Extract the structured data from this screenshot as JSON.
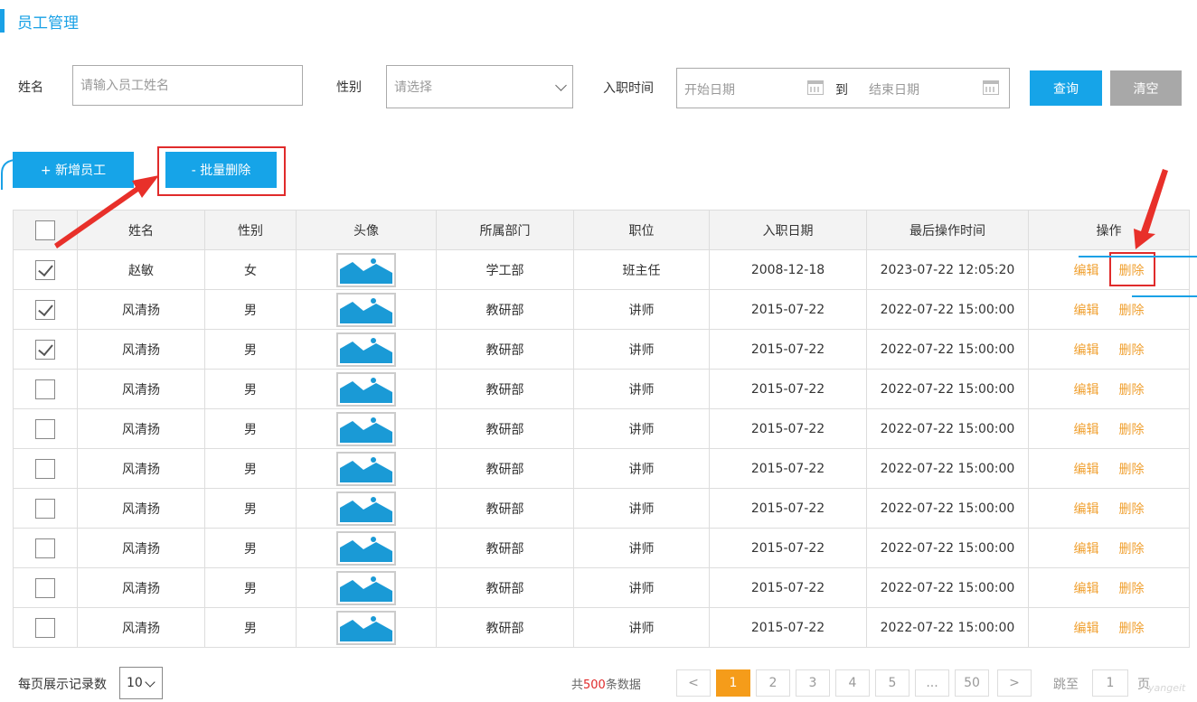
{
  "page": {
    "title": "员工管理"
  },
  "search": {
    "name_label": "姓名",
    "name_placeholder": "请输入员工姓名",
    "gender_label": "性别",
    "gender_placeholder": "请选择",
    "entry_label": "入职时间",
    "start_placeholder": "开始日期",
    "to_label": "到",
    "end_placeholder": "结束日期",
    "query_label": "查询",
    "clear_label": "清空"
  },
  "actions": {
    "add_label": "+ 新增员工",
    "batch_delete_label": "- 批量删除"
  },
  "table": {
    "headers": [
      "姓名",
      "性别",
      "头像",
      "所属部门",
      "职位",
      "入职日期",
      "最后操作时间",
      "操作"
    ],
    "edit_label": "编辑",
    "delete_label": "删除",
    "rows": [
      {
        "checked": true,
        "name": "赵敏",
        "gender": "女",
        "dept": "学工部",
        "position": "班主任",
        "entry": "2008-12-18",
        "updated": "2023-07-22 12:05:20"
      },
      {
        "checked": true,
        "name": "风清扬",
        "gender": "男",
        "dept": "教研部",
        "position": "讲师",
        "entry": "2015-07-22",
        "updated": "2022-07-22 15:00:00"
      },
      {
        "checked": true,
        "name": "风清扬",
        "gender": "男",
        "dept": "教研部",
        "position": "讲师",
        "entry": "2015-07-22",
        "updated": "2022-07-22 15:00:00"
      },
      {
        "checked": false,
        "name": "风清扬",
        "gender": "男",
        "dept": "教研部",
        "position": "讲师",
        "entry": "2015-07-22",
        "updated": "2022-07-22 15:00:00"
      },
      {
        "checked": false,
        "name": "风清扬",
        "gender": "男",
        "dept": "教研部",
        "position": "讲师",
        "entry": "2015-07-22",
        "updated": "2022-07-22 15:00:00"
      },
      {
        "checked": false,
        "name": "风清扬",
        "gender": "男",
        "dept": "教研部",
        "position": "讲师",
        "entry": "2015-07-22",
        "updated": "2022-07-22 15:00:00"
      },
      {
        "checked": false,
        "name": "风清扬",
        "gender": "男",
        "dept": "教研部",
        "position": "讲师",
        "entry": "2015-07-22",
        "updated": "2022-07-22 15:00:00"
      },
      {
        "checked": false,
        "name": "风清扬",
        "gender": "男",
        "dept": "教研部",
        "position": "讲师",
        "entry": "2015-07-22",
        "updated": "2022-07-22 15:00:00"
      },
      {
        "checked": false,
        "name": "风清扬",
        "gender": "男",
        "dept": "教研部",
        "position": "讲师",
        "entry": "2015-07-22",
        "updated": "2022-07-22 15:00:00"
      },
      {
        "checked": false,
        "name": "风清扬",
        "gender": "男",
        "dept": "教研部",
        "position": "讲师",
        "entry": "2015-07-22",
        "updated": "2022-07-22 15:00:00"
      }
    ]
  },
  "footer": {
    "page_size_label": "每页展示记录数",
    "page_size_value": "10",
    "total_prefix": "共",
    "total_count": "500",
    "total_suffix": "条数据",
    "prev": "<",
    "pages": [
      "1",
      "2",
      "3",
      "4",
      "5",
      "...",
      "50"
    ],
    "current_page": "1",
    "next": ">",
    "jump_label": "跳至",
    "jump_value": "1",
    "page_unit": "页",
    "watermark": "yangeit"
  },
  "colors": {
    "primary": "#16a4e8",
    "warning": "#f0a030",
    "danger": "#e02b2b",
    "muted": "#a8a8a8"
  }
}
